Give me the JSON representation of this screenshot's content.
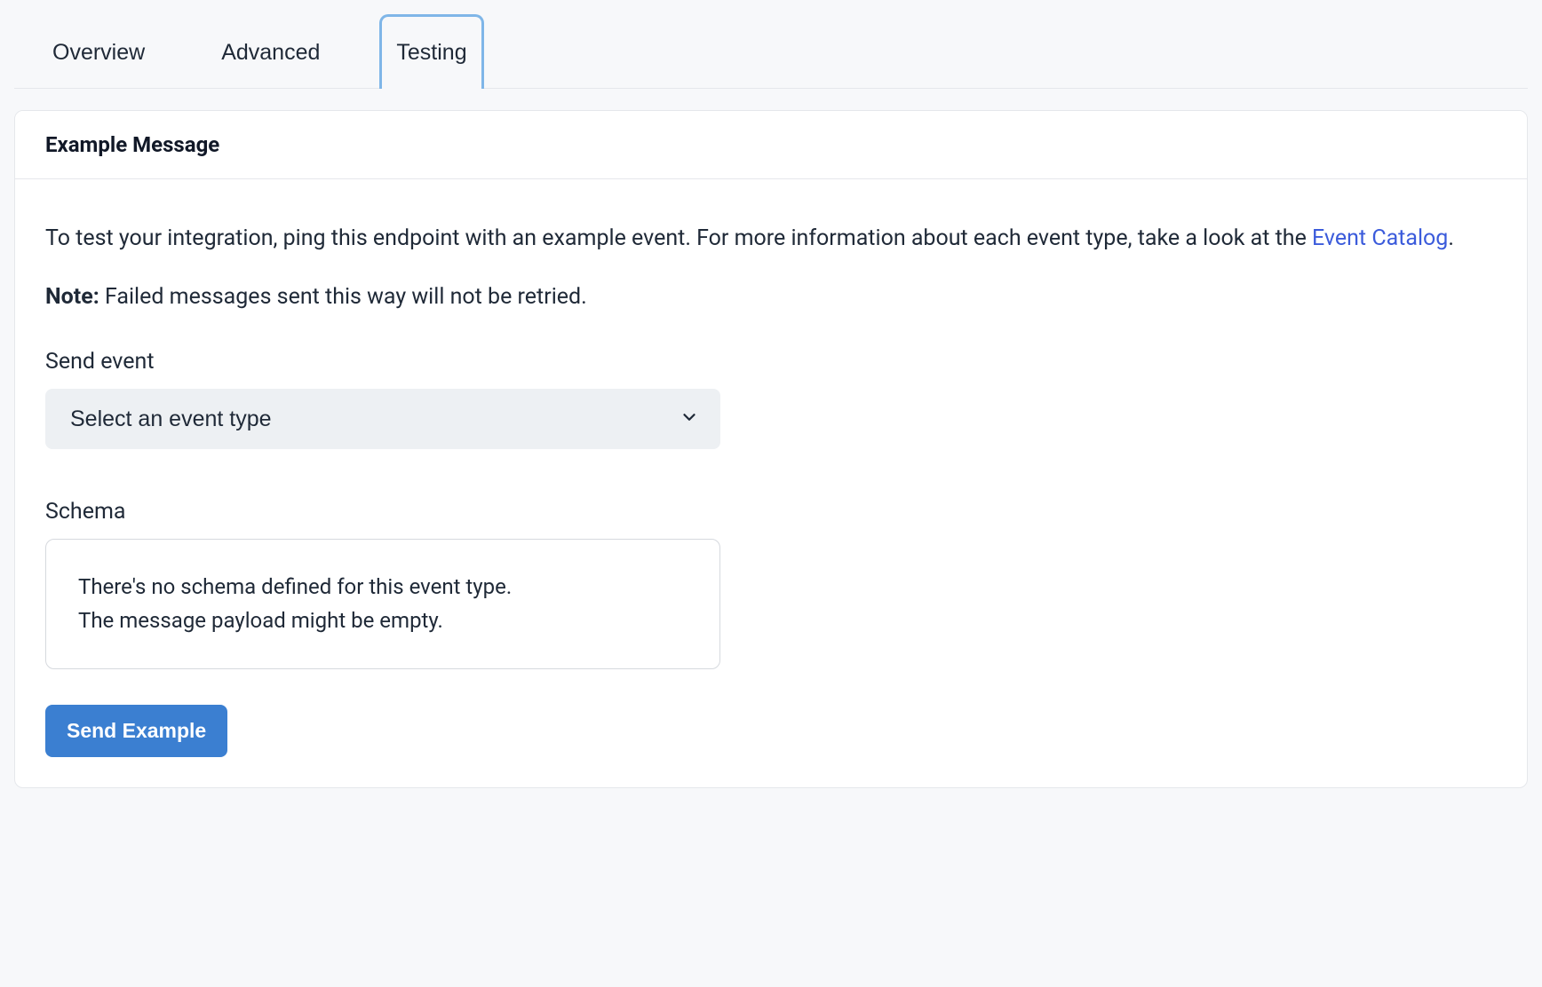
{
  "tabs": {
    "overview": "Overview",
    "advanced": "Advanced",
    "testing": "Testing"
  },
  "card": {
    "title": "Example Message",
    "description_prefix": "To test your integration, ping this endpoint with an example event. For more information about each event type, take a look at the ",
    "description_link": "Event Catalog",
    "description_suffix": ".",
    "note_label": "Note:",
    "note_text": " Failed messages sent this way will not be retried.",
    "send_event_label": "Send event",
    "select_placeholder": "Select an event type",
    "schema_label": "Schema",
    "schema_line1": "There's no schema defined for this event type.",
    "schema_line2": "The message payload might be empty.",
    "send_button": "Send Example"
  }
}
